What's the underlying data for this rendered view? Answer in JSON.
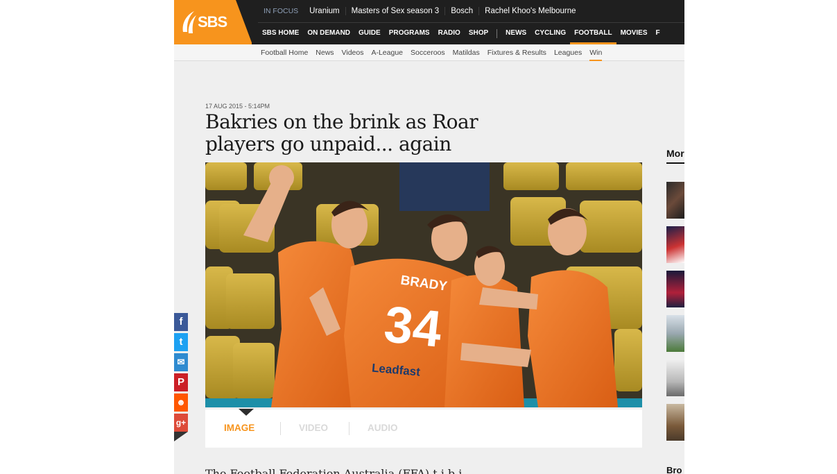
{
  "brand": {
    "name": "SBS",
    "color": "#f7941d"
  },
  "in_focus": {
    "label": "IN FOCUS",
    "items": [
      "Uranium",
      "Masters of Sex season 3",
      "Bosch",
      "Rachel Khoo's Melbourne"
    ]
  },
  "main_nav": {
    "left": [
      "SBS HOME",
      "ON DEMAND",
      "GUIDE",
      "PROGRAMS",
      "RADIO",
      "SHOP"
    ],
    "right": [
      "NEWS",
      "CYCLING",
      "FOOTBALL",
      "MOVIES",
      "F"
    ],
    "active": "FOOTBALL"
  },
  "sub_nav": {
    "items": [
      "Football Home",
      "News",
      "Videos",
      "A-League",
      "Socceroos",
      "Matildas",
      "Fixtures & Results",
      "Leagues",
      "Win"
    ],
    "active": "Win"
  },
  "article": {
    "date": "17 AUG 2015 - 5:14PM",
    "headline_line1": "Bakries on the brink as Roar",
    "headline_line2": "players go unpaid... again",
    "photo": {
      "shirt_name_1": "BRADY",
      "shirt_number_1": "34",
      "sponsor": "Leadfast"
    },
    "body_start": "The                  Football Federation Australia (FFA) t       i         b      i"
  },
  "media_tabs": [
    {
      "label": "IMAGE",
      "active": true
    },
    {
      "label": "VIDEO",
      "active": false
    },
    {
      "label": "AUDIO",
      "active": false
    }
  ],
  "sidebar": {
    "heading": "Mor",
    "heading2": "Bro"
  },
  "share": [
    {
      "icon": "facebook-icon",
      "glyph": "f",
      "color": "#3b5998"
    },
    {
      "icon": "twitter-icon",
      "glyph": "t",
      "color": "#1da1f2"
    },
    {
      "icon": "email-icon",
      "glyph": "✉",
      "color": "#2f8bd0"
    },
    {
      "icon": "pinterest-icon",
      "glyph": "P",
      "color": "#cb2027"
    },
    {
      "icon": "reddit-icon",
      "glyph": "☻",
      "color": "#ff5700"
    },
    {
      "icon": "google-plus-icon",
      "glyph": "g+",
      "color": "#dd4b39"
    }
  ],
  "colors": {
    "accent": "#f7941d",
    "header": "#1f1f1f",
    "inactive_tab": "#d9d9d9"
  }
}
